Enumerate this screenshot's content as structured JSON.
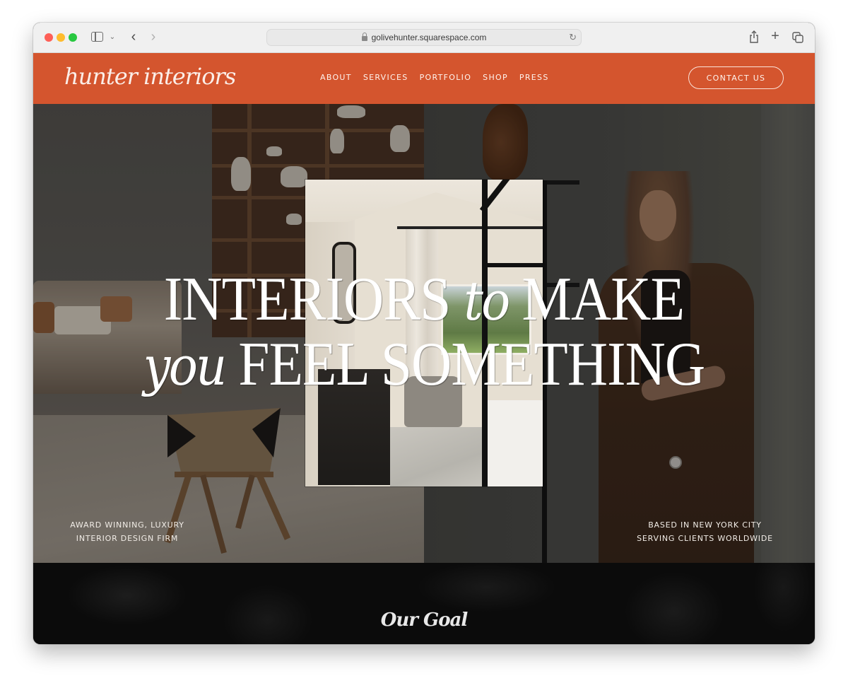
{
  "browser": {
    "url": "golivehunter.squarespace.com",
    "icons": {
      "close": "close-window-icon",
      "minimize": "minimize-window-icon",
      "zoom": "zoom-window-icon",
      "sidebar": "sidebar-icon",
      "sidebar_menu": "chevron-down-icon",
      "back": "chevron-left-icon",
      "forward": "chevron-right-icon",
      "lock": "lock-icon",
      "reload": "reload-icon",
      "share": "share-icon",
      "new_tab": "plus-icon",
      "tabs": "tab-overview-icon"
    },
    "glyphs": {
      "chevron_down": "⌄",
      "back": "‹",
      "forward": "›",
      "reload": "↻",
      "plus": "+"
    }
  },
  "site": {
    "logo": "hunter interiors",
    "brand_color": "#d4552e",
    "nav": [
      {
        "label": "ABOUT"
      },
      {
        "label": "SERVICES"
      },
      {
        "label": "PORTFOLIO"
      },
      {
        "label": "SHOP"
      },
      {
        "label": "PRESS"
      }
    ],
    "cta_label": "CONTACT US"
  },
  "hero": {
    "headline": {
      "line1_a": "INTERIORS",
      "line1_italic": "to",
      "line1_b": "MAKE",
      "line2_italic": "you",
      "line2_b": "FEEL SOMETHING"
    },
    "tagline_left": [
      "AWARD WINNING, LUXURY",
      "INTERIOR DESIGN FIRM"
    ],
    "tagline_right": [
      "BASED IN NEW YORK CITY",
      "SERVING CLIENTS WORLDWIDE"
    ],
    "images": {
      "left": "living room with wooden shelving, sofa and woven chair",
      "center": "bedroom with canopy bed, dresser and window",
      "right": "portrait of designer in brown suit"
    }
  },
  "goal": {
    "title": "Our Goal"
  }
}
